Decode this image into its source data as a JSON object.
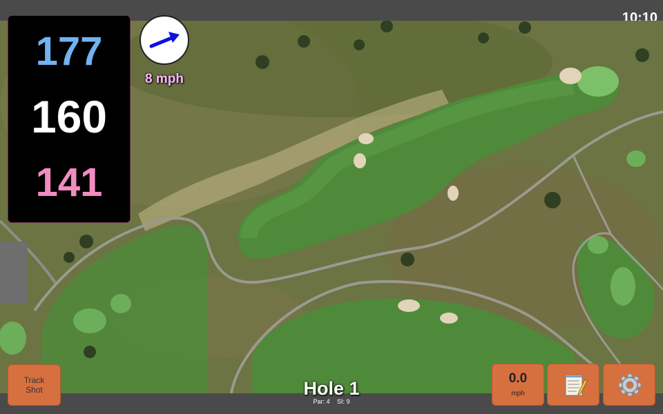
{
  "status_bar": {
    "time": "10:10"
  },
  "yardages": {
    "back": "177",
    "middle": "160",
    "front": "141"
  },
  "wind": {
    "speed_label": "8 mph",
    "icon": "wind-arrow-icon"
  },
  "buttons": {
    "track_shot_line1": "Track",
    "track_shot_line2": "Shot",
    "wind_value": "0.0",
    "wind_unit": "mph",
    "notes_icon": "notepad-icon",
    "settings_icon": "gear-icon"
  },
  "hole": {
    "title": "Hole 1",
    "par": "Par: 4",
    "si": "SI: 9"
  },
  "colors": {
    "button": "#d6703f",
    "back_yardage": "#6fb3f2",
    "front_yardage": "#f08cc0",
    "wind_label": "#ffb7ff"
  }
}
